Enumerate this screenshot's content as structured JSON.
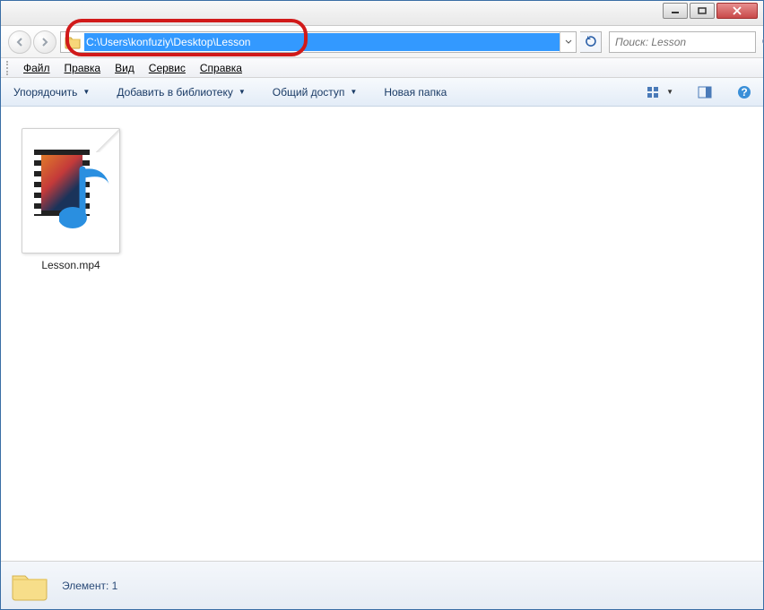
{
  "titlebar": {
    "min_aria": "Minimize",
    "max_aria": "Maximize",
    "close_aria": "Close"
  },
  "nav": {
    "back_aria": "Back",
    "forward_aria": "Forward",
    "address_path": "C:\\Users\\konfuziy\\Desktop\\Lesson",
    "refresh_aria": "Refresh",
    "search_placeholder": "Поиск: Lesson"
  },
  "menubar": {
    "file": "Файл",
    "edit": "Правка",
    "view": "Вид",
    "tools": "Сервис",
    "help": "Справка"
  },
  "toolbar": {
    "organize": "Упорядочить",
    "add_library": "Добавить в библиотеку",
    "share": "Общий доступ",
    "new_folder": "Новая папка",
    "view_aria": "Change view",
    "preview_aria": "Preview pane",
    "help_aria": "Help"
  },
  "files": [
    {
      "name": "Lesson.mp4"
    }
  ],
  "status": {
    "text": "Элемент: 1"
  }
}
